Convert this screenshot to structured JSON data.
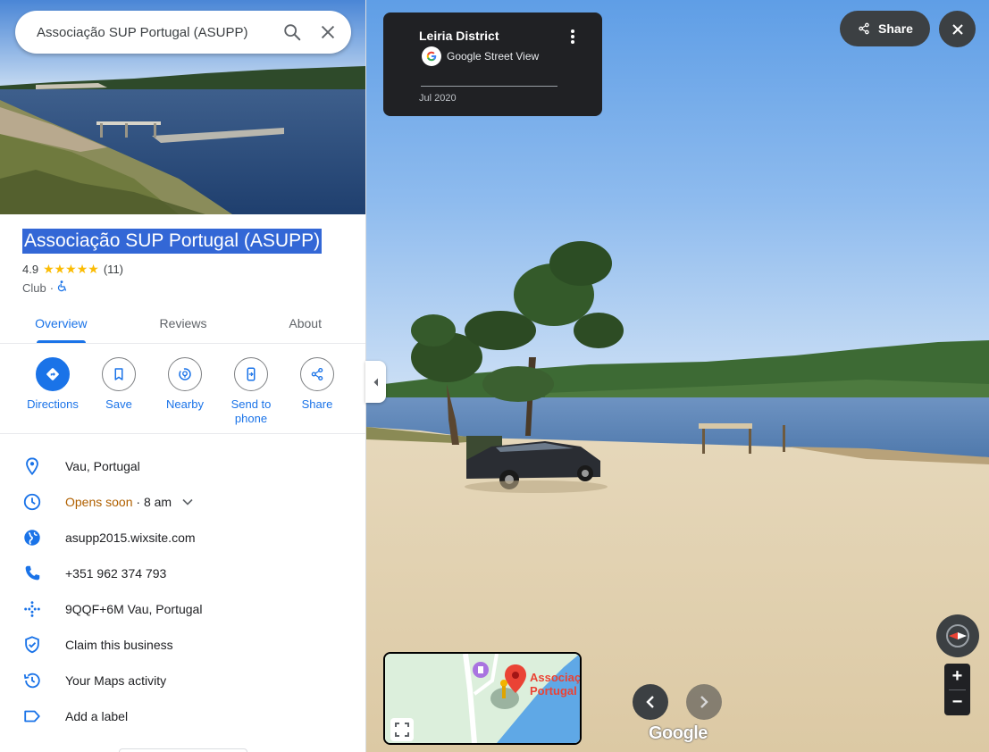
{
  "search": {
    "query": "Associação SUP Portugal (ASUPP)"
  },
  "place": {
    "title": "Associação SUP Portugal (ASUPP)",
    "rating": "4.9",
    "stars": "★★★★★",
    "review_count": "(11)",
    "category": "Club",
    "category_sep": "·",
    "accessibility_icon": "wheelchair-icon"
  },
  "tabs": [
    {
      "label": "Overview",
      "active": true
    },
    {
      "label": "Reviews",
      "active": false
    },
    {
      "label": "About",
      "active": false
    }
  ],
  "actions": [
    {
      "label": "Directions",
      "icon": "directions-icon"
    },
    {
      "label": "Save",
      "icon": "bookmark-icon"
    },
    {
      "label": "Nearby",
      "icon": "nearby-icon"
    },
    {
      "label": "Send to phone",
      "icon": "send-to-phone-icon"
    },
    {
      "label": "Share",
      "icon": "share-icon"
    }
  ],
  "info": {
    "address": "Vau, Portugal",
    "hours_status": "Opens soon",
    "hours_sep": " · ",
    "hours_time": "8 am",
    "website": "asupp2015.wixsite.com",
    "phone": "+351 962 374 793",
    "plus_code": "9QQF+6M Vau, Portugal",
    "claim": "Claim this business",
    "maps_activity": "Your Maps activity",
    "add_label": "Add a label"
  },
  "streetview": {
    "location": "Leiria District",
    "provider": "Google Street View",
    "date": "Jul 2020",
    "share_label": "Share",
    "minimap_label_line1": "Associaç",
    "minimap_label_line2": "Portugal",
    "logo": "Google"
  },
  "colors": {
    "accent": "#1a73e8",
    "selection": "#3367d6",
    "open_soon": "#b06000",
    "star": "#fbbc04",
    "dark_button": "#3c4043"
  }
}
